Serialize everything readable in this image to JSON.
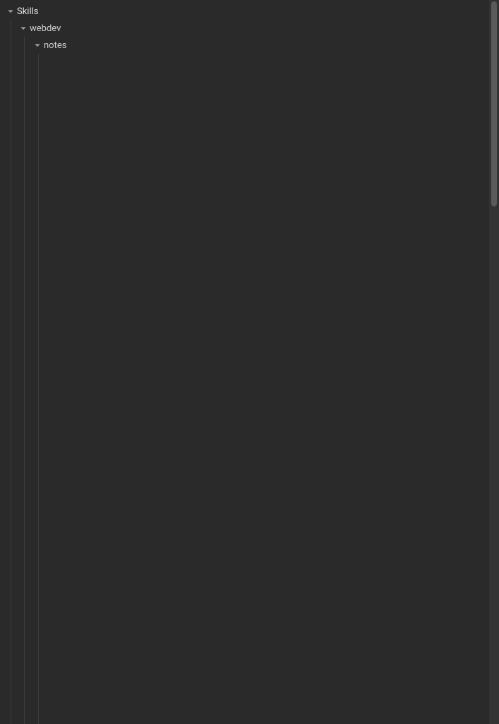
{
  "tree": {
    "items": [
      {
        "label": "Skills",
        "level": 0,
        "expanded": true
      },
      {
        "label": "webdev",
        "level": 1,
        "expanded": true
      },
      {
        "label": "notes",
        "level": 2,
        "expanded": true
      }
    ]
  }
}
